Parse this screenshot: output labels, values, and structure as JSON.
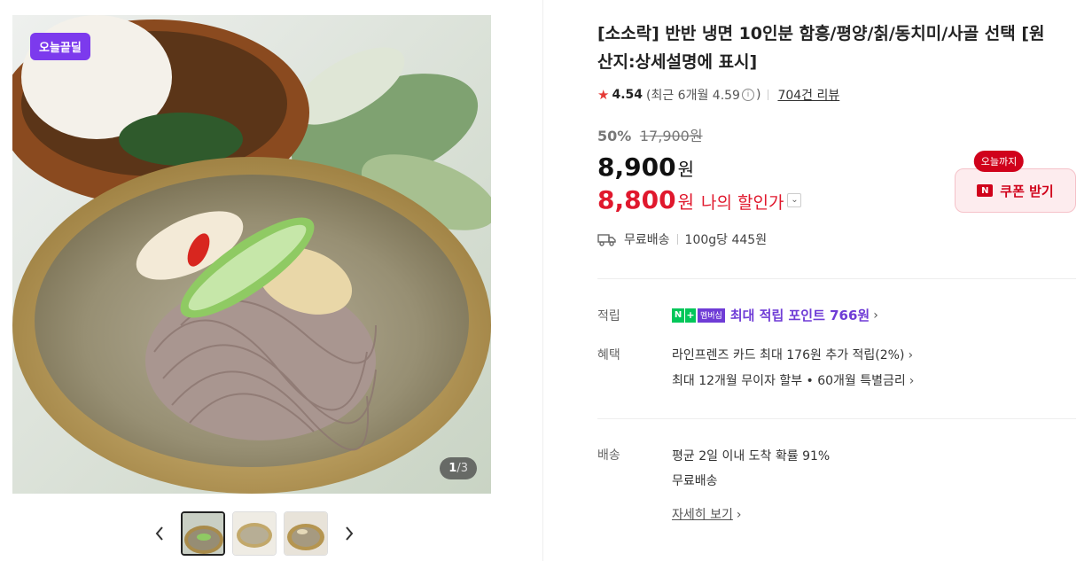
{
  "gallery": {
    "badge": "오늘끝딜",
    "counter_current": "1",
    "counter_total": "/3",
    "thumbnail_count": 3,
    "active_thumbnail": 1
  },
  "product": {
    "title": "[소소락] 반반 냉면 10인분 함흥/평양/칡/동치미/사골 선택 [원산지:상세설명에 표시]",
    "rating": "4.54",
    "recent_rating": "(최근 6개월 4.59",
    "recent_rating_close": ")",
    "review_link": "704건 리뷰",
    "discount_rate": "50%",
    "original_price": "17,900원",
    "sale_price": "8,900",
    "sale_won": "원",
    "my_price": "8,800",
    "my_won": "원",
    "my_price_label": "나의 할인가",
    "coupon_tag": "오늘까지",
    "coupon_button": "쿠폰 받기",
    "coupon_icon": "N",
    "shipping": "무료배송",
    "unit_price": "100g당 445원"
  },
  "benefits": {
    "points_label": "적립",
    "membership_n": "N",
    "membership_plus": "+",
    "membership_text": "멤버십",
    "points_text": "최대 적립 포인트 766원",
    "benefit_label": "혜택",
    "card_benefit": "라인프렌즈 카드 최대 176원 추가 적립(2%)",
    "installment": "최대 12개월 무이자 할부 • 60개월 특별금리"
  },
  "delivery": {
    "label": "배송",
    "arrival": "평균 2일 이내 도착 확률 91%",
    "fee": "무료배송",
    "detail_link": "자세히 보기"
  },
  "colors": {
    "accent_red": "#e0182d",
    "badge_purple": "#7c3aed",
    "point_purple": "#6f3cd6",
    "naver_green": "#03c75a"
  }
}
